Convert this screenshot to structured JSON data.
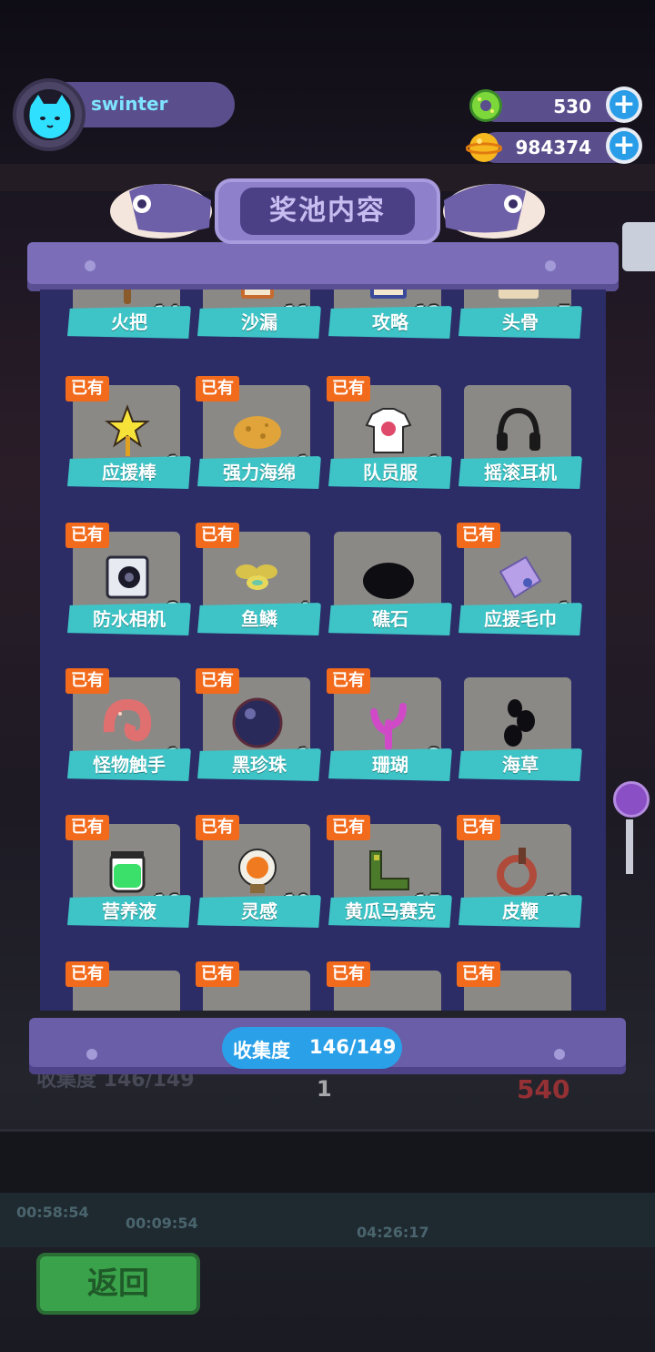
{
  "user": {
    "name": "swinter"
  },
  "currency": {
    "donut": {
      "value": "530",
      "plus": "+",
      "icon": "green-donut-icon"
    },
    "coin": {
      "value": "984374",
      "plus": "+",
      "icon": "gold-planet-coin-icon"
    }
  },
  "modal": {
    "title": "奖池内容",
    "collection_label": "收集度",
    "collection_value": "146/149",
    "owned_badge": "已有"
  },
  "items_row0": [
    {
      "name": "火把",
      "count": "x14",
      "icon": "torch-icon"
    },
    {
      "name": "沙漏",
      "count": "x11",
      "icon": "hourglass-icon"
    },
    {
      "name": "攻略",
      "count": "x12",
      "icon": "guide-book-icon"
    },
    {
      "name": "头骨",
      "count": "x7",
      "icon": "skull-icon"
    }
  ],
  "items_row1": [
    {
      "name": "应援棒",
      "count": "x1",
      "owned": true,
      "icon": "star-wand-icon"
    },
    {
      "name": "强力海绵",
      "count": "x1",
      "owned": true,
      "icon": "sponge-icon"
    },
    {
      "name": "队员服",
      "count": "x1",
      "owned": true,
      "icon": "t-shirt-icon"
    },
    {
      "name": "摇滚耳机",
      "count": "",
      "owned": false,
      "icon": "headphones-icon"
    }
  ],
  "items_row2": [
    {
      "name": "防水相机",
      "count": "x2",
      "owned": true,
      "icon": "camera-icon"
    },
    {
      "name": "鱼鳞",
      "count": "x4",
      "owned": true,
      "icon": "fish-scale-icon"
    },
    {
      "name": "礁石",
      "count": "",
      "owned": false,
      "icon": "rock-icon"
    },
    {
      "name": "应援毛巾",
      "count": "x1",
      "owned": true,
      "icon": "towel-icon"
    }
  ],
  "items_row3": [
    {
      "name": "怪物触手",
      "count": "x1",
      "owned": true,
      "icon": "tentacle-icon"
    },
    {
      "name": "黑珍珠",
      "count": "x1",
      "owned": true,
      "icon": "black-pearl-icon"
    },
    {
      "name": "珊瑚",
      "count": "x3",
      "owned": true,
      "icon": "coral-icon"
    },
    {
      "name": "海草",
      "count": "",
      "owned": false,
      "icon": "seaweed-icon"
    }
  ],
  "items_row4": [
    {
      "name": "营养液",
      "count": "x16",
      "owned": true,
      "icon": "nutrient-jar-icon"
    },
    {
      "name": "灵感",
      "count": "x19",
      "owned": true,
      "icon": "lightbulb-icon"
    },
    {
      "name": "黄瓜马赛克",
      "count": "x15",
      "owned": true,
      "icon": "cucumber-icon"
    },
    {
      "name": "皮鞭",
      "count": "x12",
      "owned": true,
      "icon": "whip-icon"
    }
  ],
  "background": {
    "back_button": "返回",
    "bg_collection": "收集度 146/149",
    "bg_stat_1": "1",
    "bg_stat_540": "540",
    "timer_1": "00:58:54",
    "timer_2": "00:09:54",
    "timer_3": "04:26:17"
  },
  "colors": {
    "panel": "#2c2c66",
    "frame": "#7b6db8",
    "card": "#8a8986",
    "label": "#3ec4c6",
    "badge": "#f26a1b",
    "accent_blue": "#2aa0e8"
  }
}
